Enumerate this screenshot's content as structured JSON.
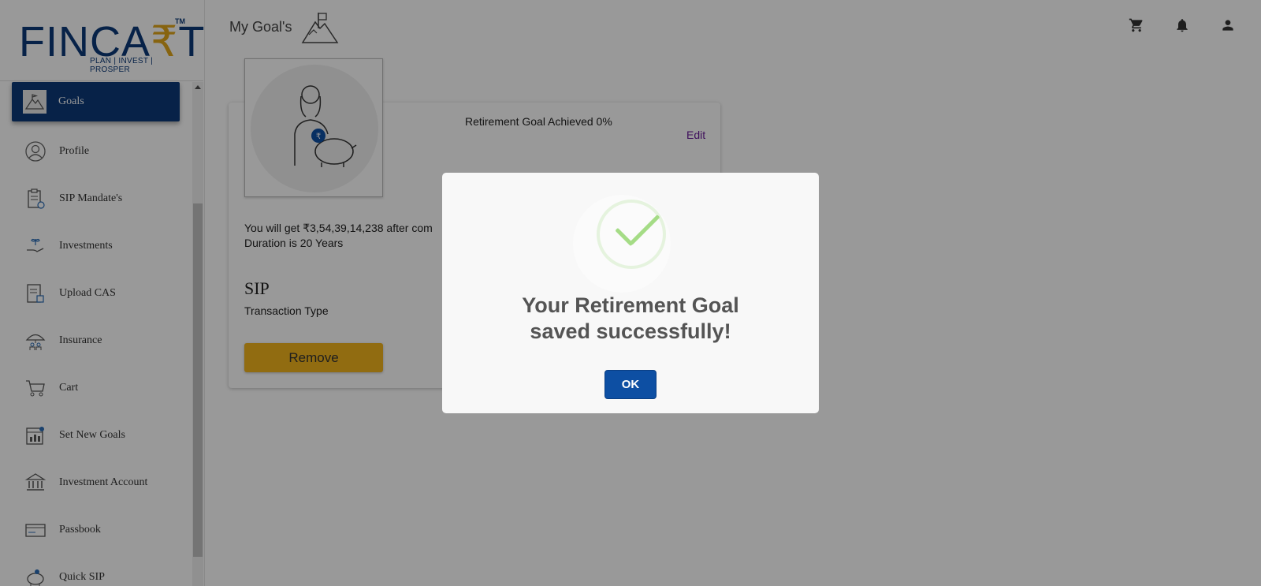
{
  "brand": {
    "logo_prefix": "FINCA",
    "logo_accent": "₹",
    "logo_suffix": "T",
    "tm": "TM",
    "tagline": "PLAN | INVEST | PROSPER",
    "primary_color": "#0d3a78",
    "accent_color": "#e2a71c"
  },
  "header": {
    "title": "My Goal's",
    "title_icon": "mountain-flag-icon",
    "actions": [
      {
        "name": "cart-icon"
      },
      {
        "name": "bell-icon"
      },
      {
        "name": "user-icon"
      }
    ]
  },
  "sidebar": {
    "items": [
      {
        "label": "Goals",
        "icon": "goals-icon",
        "active": true
      },
      {
        "label": "Profile",
        "icon": "profile-icon"
      },
      {
        "label": "SIP Mandate's",
        "icon": "clipboard-icon"
      },
      {
        "label": "Investments",
        "icon": "investments-icon"
      },
      {
        "label": "Upload CAS",
        "icon": "upload-document-icon"
      },
      {
        "label": "Insurance",
        "icon": "umbrella-family-icon"
      },
      {
        "label": "Cart",
        "icon": "cart-icon"
      },
      {
        "label": "Set New Goals",
        "icon": "calendar-chart-icon"
      },
      {
        "label": "Investment Account",
        "icon": "bank-icon"
      },
      {
        "label": "Passbook",
        "icon": "card-icon"
      },
      {
        "label": "Quick SIP",
        "icon": "piggy-bank-icon"
      }
    ]
  },
  "goal_card": {
    "status": "Retirement Goal Achieved 0%",
    "edit_label": "Edit",
    "description_line1": "You will get ₹3,54,39,14,238 after com",
    "description_line2": "Duration is 20 Years",
    "transaction_value": "SIP",
    "transaction_label": "Transaction Type",
    "remove_label": "Remove"
  },
  "modal": {
    "message": "Your Retirement Goal saved successfully!",
    "ok_label": "OK",
    "success_color": "#a5dc86",
    "ok_color": "#0d4fa3"
  }
}
